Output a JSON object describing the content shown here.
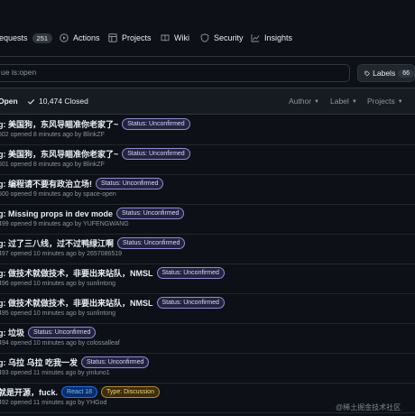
{
  "nav": {
    "items": [
      {
        "label": "requests",
        "count": "251",
        "icon": "pull-request-icon"
      },
      {
        "label": "Actions",
        "icon": "play-circle-icon"
      },
      {
        "label": "Projects",
        "icon": "table-icon"
      },
      {
        "label": "Wiki",
        "icon": "book-icon"
      },
      {
        "label": "Security",
        "icon": "shield-icon"
      },
      {
        "label": "Insights",
        "icon": "graph-icon"
      }
    ]
  },
  "filter": {
    "search_value": "ue is:open",
    "labels_button": {
      "label": "Labels",
      "count": "66"
    }
  },
  "list_header": {
    "open_label": "Open",
    "closed_label": "10,474 Closed",
    "author": "Author",
    "label": "Label",
    "projects": "Projects"
  },
  "issues": [
    {
      "title": "g: 美国狗，东风导瞄准你老家了~",
      "labels": [
        "Status: Unconfirmed"
      ],
      "meta": "502 opened 8 minutes ago by BlinkZF"
    },
    {
      "title": "g: 美国狗，东风导瞄准你老家了~",
      "labels": [
        "Status: Unconfirmed"
      ],
      "meta": "501 opened 8 minutes ago by BlinkZF"
    },
    {
      "title": "g: 编程请不要有政治立场!",
      "labels": [
        "Status: Unconfirmed"
      ],
      "meta": "500 opened 9 minutes ago by space-open"
    },
    {
      "title": "g: Missing props in dev mode",
      "labels": [
        "Status: Unconfirmed"
      ],
      "meta": "499 opened 9 minutes ago by YUFENGWANG"
    },
    {
      "title": "g: 过了三八线，过不过鸭绿江啊",
      "labels": [
        "Status: Unconfirmed"
      ],
      "meta": "497 opened 10 minutes ago by 2657086519"
    },
    {
      "title": "g: 做技术就做技术，非要出来站队，NMSL",
      "labels": [
        "Status: Unconfirmed"
      ],
      "meta": "496 opened 10 minutes ago by sunlintong"
    },
    {
      "title": "g: 做技术就做技术，非要出来站队，NMSL",
      "labels": [
        "Status: Unconfirmed"
      ],
      "meta": "495 opened 10 minutes ago by sunlintong"
    },
    {
      "title": "g: 垃圾",
      "labels": [
        "Status: Unconfirmed"
      ],
      "meta": "494 opened 10 minutes ago by colossalleaf"
    },
    {
      "title": "g: 乌拉 乌拉 吃我一发",
      "labels": [
        "Status: Unconfirmed"
      ],
      "meta": "493 opened 11 minutes ago by yinluno1"
    },
    {
      "title": "就是开源，fuck.",
      "labels": [
        "React 18",
        "Type: Discussion"
      ],
      "meta": "492 opened 11 minutes ago by YHGod"
    }
  ],
  "colors": {
    "background": "#0d1117",
    "border": "#30363d",
    "label_unconfirmed": "#8e8cd0",
    "label_react": "#1f6feb",
    "label_discussion": "#b58a2a"
  },
  "watermark": "@稀土掘金技术社区"
}
